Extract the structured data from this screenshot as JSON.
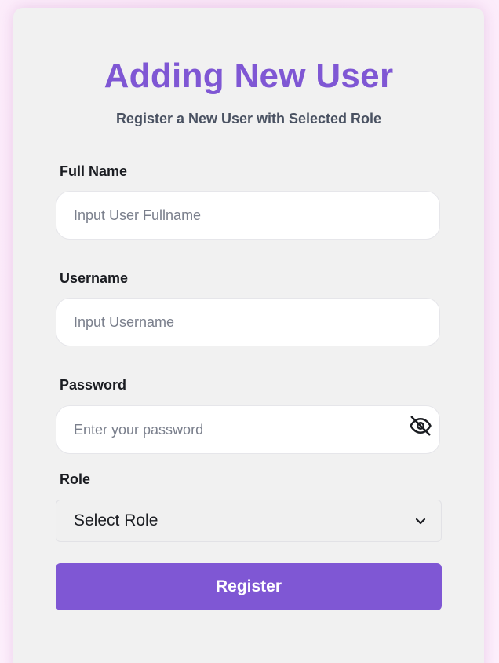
{
  "header": {
    "title": "Adding New User",
    "subtitle": "Register a New User with Selected Role"
  },
  "form": {
    "full_name": {
      "label": "Full Name",
      "placeholder": "Input User Fullname",
      "value": ""
    },
    "username": {
      "label": "Username",
      "placeholder": "Input Username",
      "value": ""
    },
    "password": {
      "label": "Password",
      "placeholder": "Enter your password",
      "value": "",
      "toggle_icon": "eye-off-icon"
    },
    "role": {
      "label": "Role",
      "selected": "Select Role",
      "icon": "chevron-down-icon"
    },
    "submit_label": "Register"
  },
  "colors": {
    "accent": "#7f57d4",
    "background": "#fbe7f8",
    "card": "#f1f1f1"
  }
}
